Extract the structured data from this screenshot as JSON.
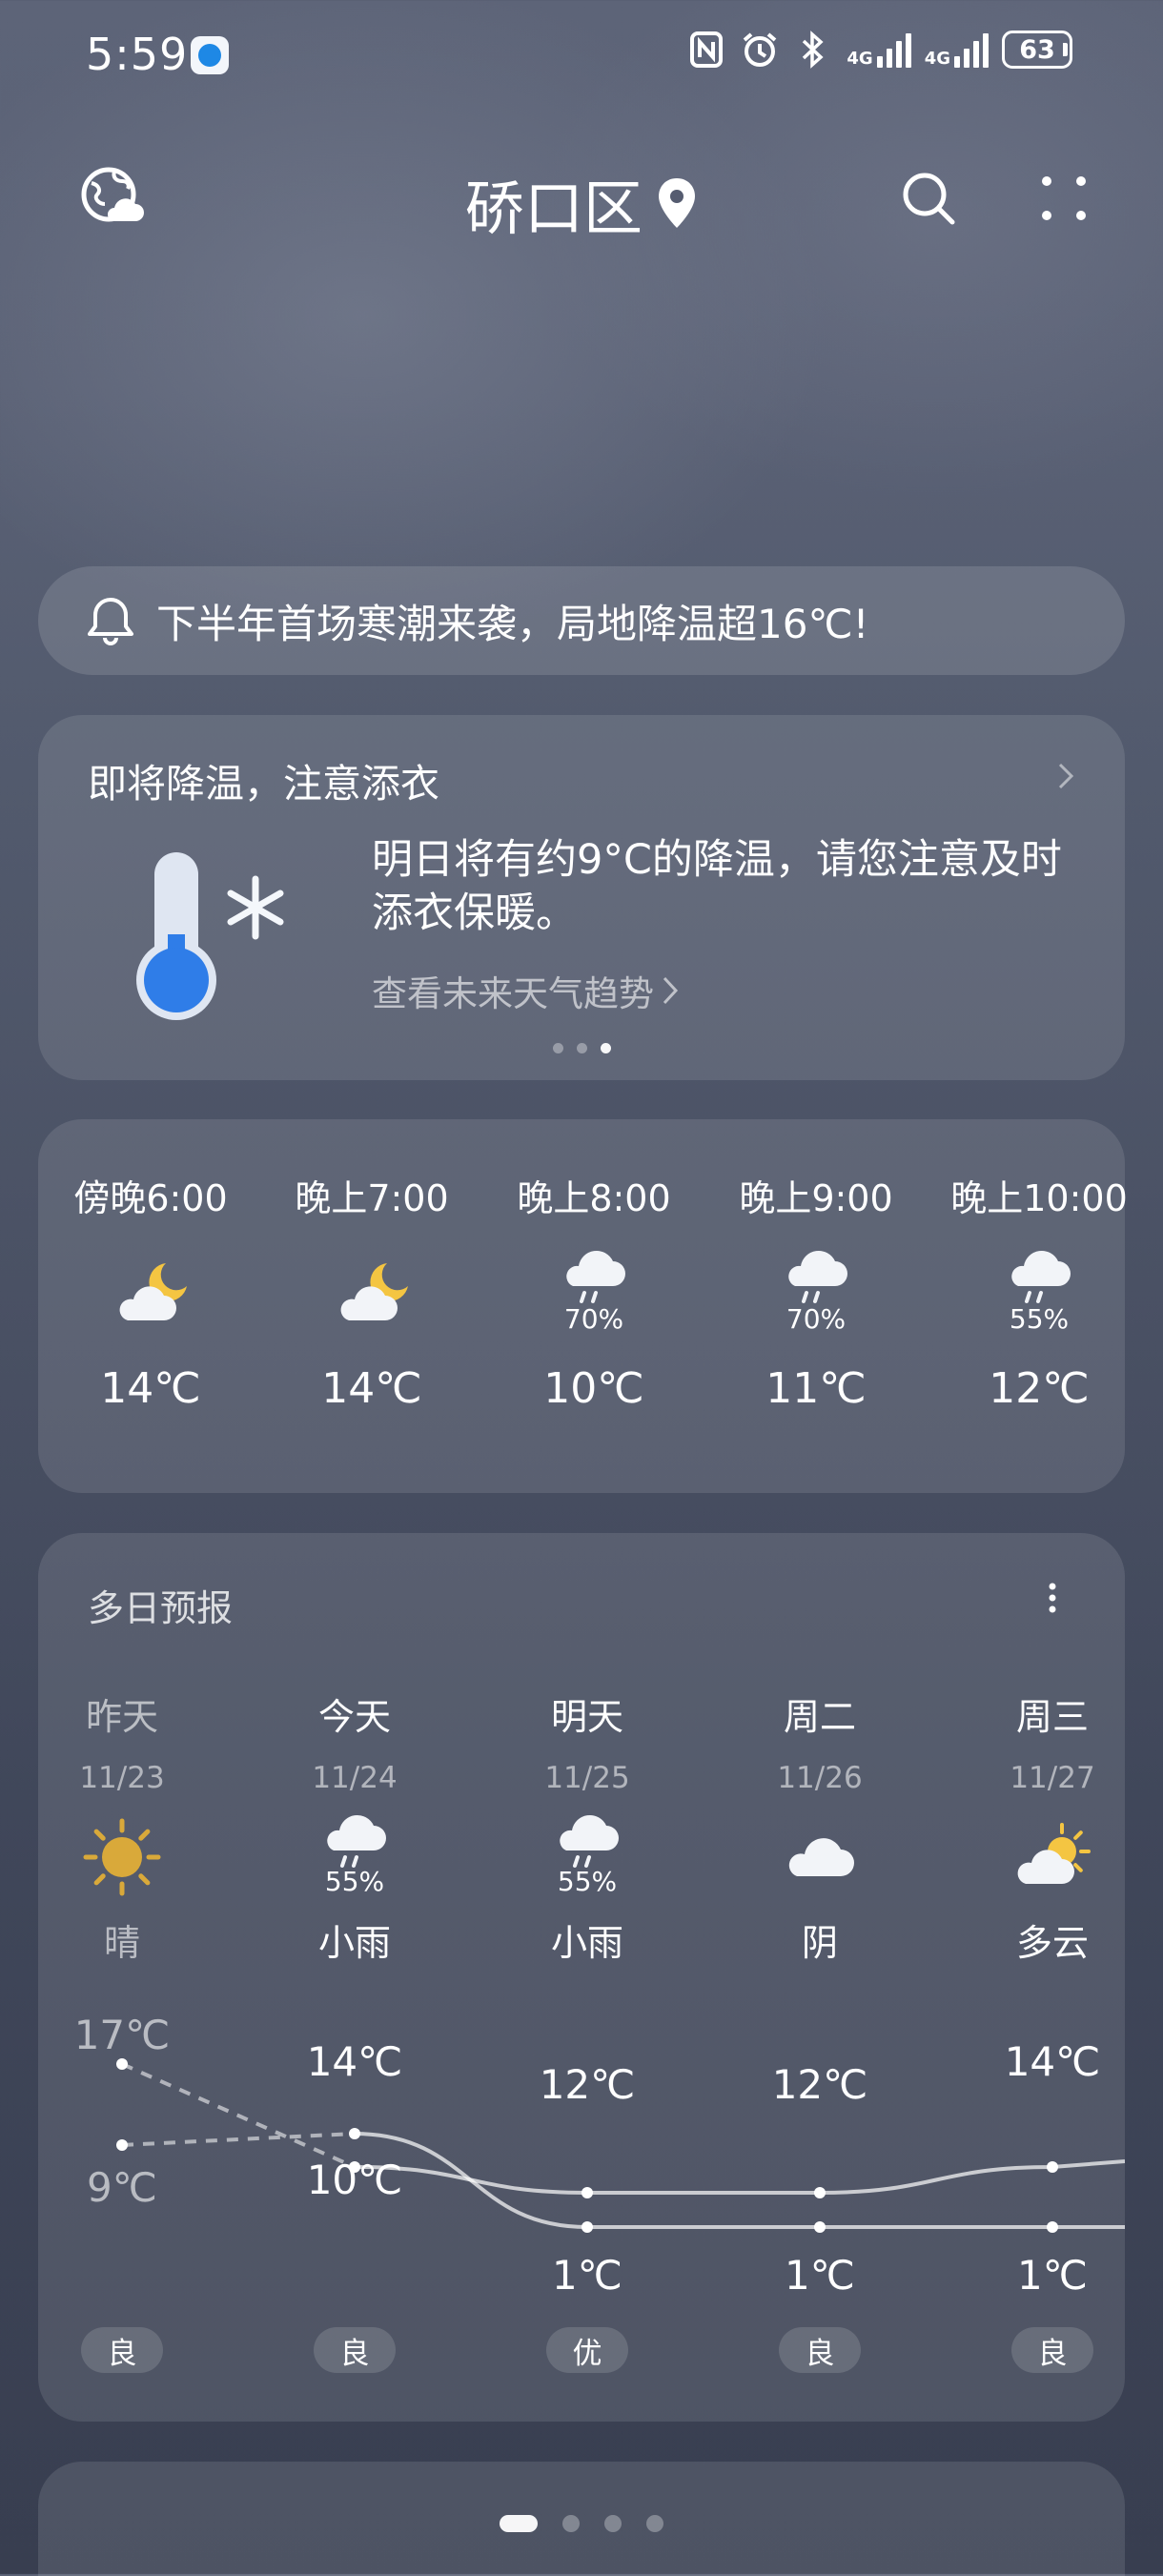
{
  "status_bar": {
    "time": "5:59",
    "battery": "63",
    "network1": "4G",
    "network2": "4G"
  },
  "header": {
    "city": "硚口区"
  },
  "alert": {
    "text": "下半年首场寒潮来袭，局地降温超16℃!"
  },
  "tip": {
    "title": "即将降温，注意添衣",
    "body": "明日将有约9°C的降温，请您注意及时添衣保暖。",
    "link": "查看未来天气趋势"
  },
  "hourly": [
    {
      "time": "傍晚6:00",
      "icon": "moon-cloud-icon",
      "prob": "",
      "temp": "14℃"
    },
    {
      "time": "晚上7:00",
      "icon": "moon-cloud-icon",
      "prob": "",
      "temp": "14℃"
    },
    {
      "time": "晚上8:00",
      "icon": "rain-cloud-icon",
      "prob": "70%",
      "temp": "10℃"
    },
    {
      "time": "晚上9:00",
      "icon": "rain-cloud-icon",
      "prob": "70%",
      "temp": "11℃"
    },
    {
      "time": "晚上10:00",
      "icon": "rain-cloud-icon",
      "prob": "55%",
      "temp": "12℃"
    }
  ],
  "daily": {
    "title": "多日预报",
    "days": [
      {
        "name": "昨天",
        "date": "11/23",
        "icon": "sun-icon",
        "prob": "",
        "cond": "晴",
        "high": "17℃",
        "low": "9℃",
        "high_value": 17,
        "low_value": 9,
        "aqi": "良"
      },
      {
        "name": "今天",
        "date": "11/24",
        "icon": "rain-cloud-icon",
        "prob": "55%",
        "cond": "小雨",
        "high": "14℃",
        "low": "10℃",
        "high_value": 14,
        "low_value": 10,
        "aqi": "良"
      },
      {
        "name": "明天",
        "date": "11/25",
        "icon": "rain-cloud-icon",
        "prob": "55%",
        "cond": "小雨",
        "high": "12℃",
        "low": "1℃",
        "high_value": 12,
        "low_value": 1,
        "aqi": "优"
      },
      {
        "name": "周二",
        "date": "11/26",
        "icon": "cloud-icon",
        "prob": "",
        "cond": "阴",
        "high": "12℃",
        "low": "1℃",
        "high_value": 12,
        "low_value": 1,
        "aqi": "良"
      },
      {
        "name": "周三",
        "date": "11/27",
        "icon": "sun-cloud-icon",
        "prob": "",
        "cond": "多云",
        "high": "14℃",
        "low": "1℃",
        "high_value": 14,
        "low_value": 1,
        "aqi": "良"
      }
    ]
  },
  "colors": {
    "sun": "#d9a93a",
    "moon": "#f4c542",
    "cloud": "#f2f4f8"
  }
}
